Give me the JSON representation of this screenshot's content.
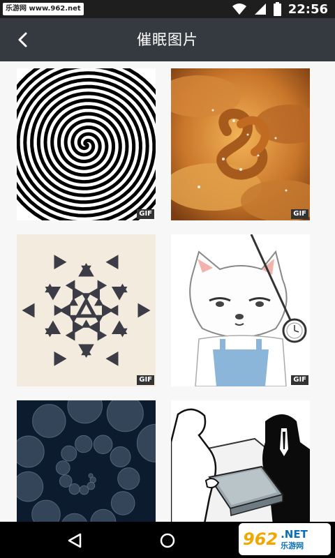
{
  "status_bar": {
    "watermark": "乐游网 www.962.net",
    "time": "22:56",
    "icons": [
      "wifi-icon",
      "signal-icon",
      "battery-icon"
    ]
  },
  "app_bar": {
    "title": "催眠图片",
    "back_icon": "back-arrow-icon"
  },
  "grid": {
    "items": [
      {
        "name": "spiral",
        "badge": "GIF"
      },
      {
        "name": "pretzel",
        "badge": "GIF"
      },
      {
        "name": "triangle-pattern",
        "badge": "GIF"
      },
      {
        "name": "cat-pendulum",
        "badge": "GIF"
      },
      {
        "name": "moon-spiral",
        "badge": ""
      },
      {
        "name": "briefcase-scene",
        "badge": ""
      }
    ]
  },
  "nav_bar": {
    "icons": [
      "back-triangle-icon",
      "home-circle-icon"
    ],
    "watermark_number": "962",
    "watermark_net": ".NET",
    "watermark_cn": "乐游网"
  },
  "colors": {
    "status_bg": "#1e1e1e",
    "app_bar_bg": "#353a40",
    "page_bg": "#f7f7f7",
    "nav_bg": "#000000"
  }
}
